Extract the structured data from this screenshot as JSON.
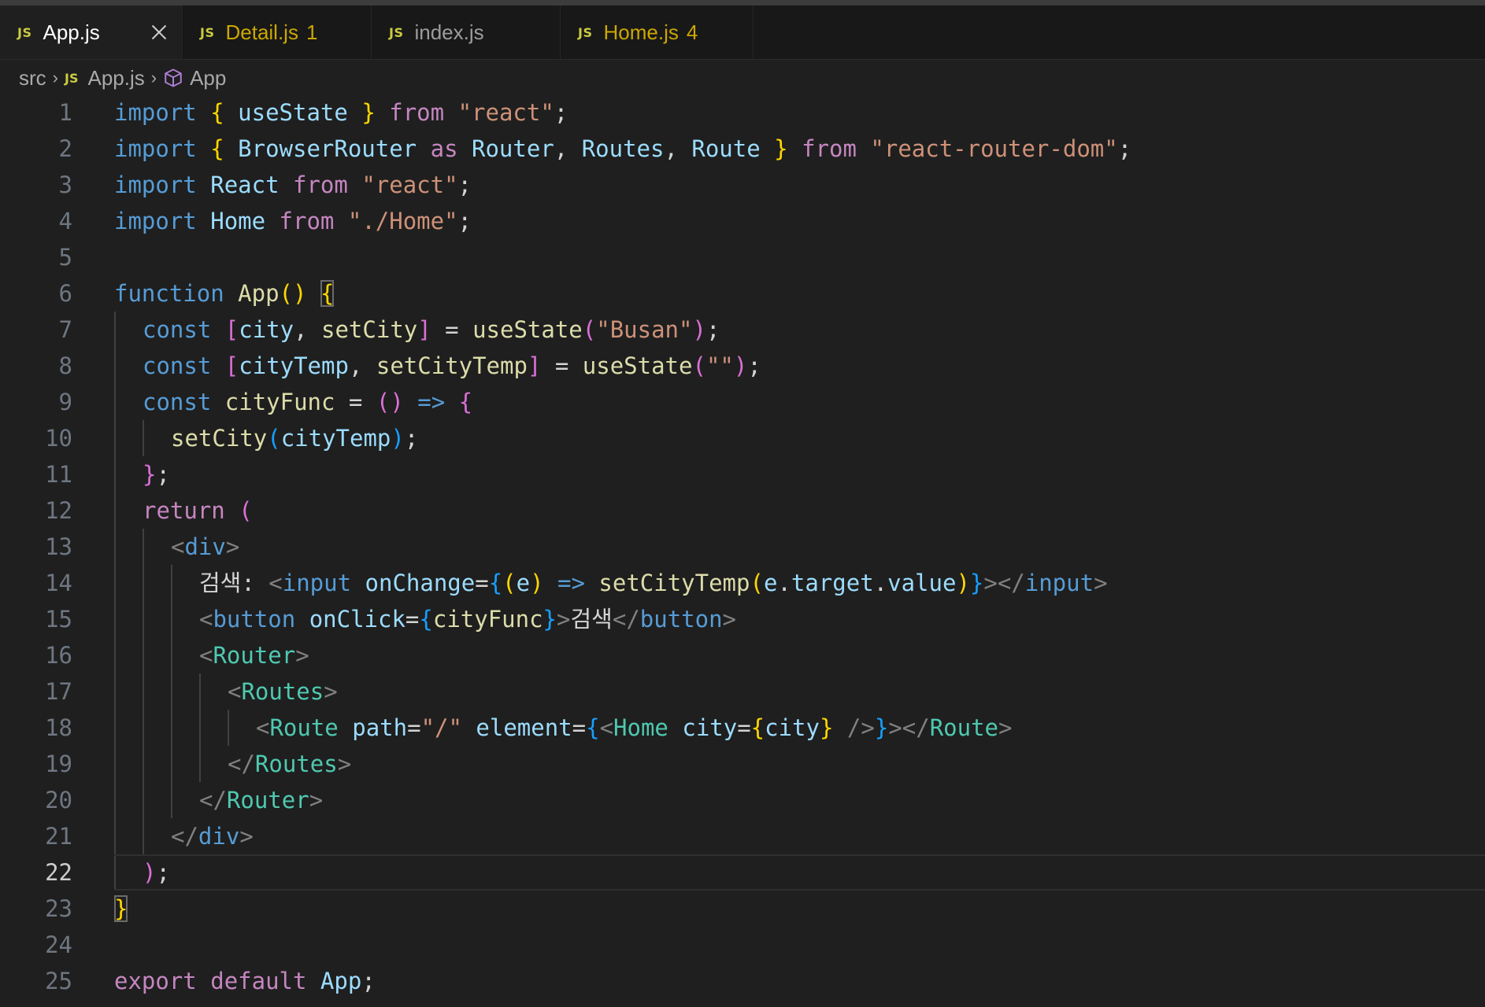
{
  "tabs": [
    {
      "icon": "JS",
      "label": "App.js",
      "count": "",
      "active": true
    },
    {
      "icon": "JS",
      "label": "Detail.js",
      "count": "1",
      "active": false
    },
    {
      "icon": "JS",
      "label": "index.js",
      "count": "",
      "active": false
    },
    {
      "icon": "JS",
      "label": "Home.js",
      "count": "4",
      "active": false
    }
  ],
  "breadcrumb": {
    "folder": "src",
    "file_icon": "JS",
    "file": "App.js",
    "symbol_icon": "symbol-class-icon",
    "symbol": "App"
  },
  "editor": {
    "current_line": 22,
    "lines": [
      {
        "n": "1",
        "indent": 0,
        "tokens": [
          [
            "kw",
            "import"
          ],
          [
            "pl",
            " "
          ],
          [
            "b1",
            "{"
          ],
          [
            "pl",
            " "
          ],
          [
            "var",
            "useState"
          ],
          [
            "pl",
            " "
          ],
          [
            "b1",
            "}"
          ],
          [
            "pl",
            " "
          ],
          [
            "ctl",
            "from"
          ],
          [
            "pl",
            " "
          ],
          [
            "str",
            "\"react\""
          ],
          [
            "pl",
            ";"
          ]
        ]
      },
      {
        "n": "2",
        "indent": 0,
        "tokens": [
          [
            "kw",
            "import"
          ],
          [
            "pl",
            " "
          ],
          [
            "b1",
            "{"
          ],
          [
            "pl",
            " "
          ],
          [
            "var",
            "BrowserRouter"
          ],
          [
            "pl",
            " "
          ],
          [
            "ctl",
            "as"
          ],
          [
            "pl",
            " "
          ],
          [
            "var",
            "Router"
          ],
          [
            "pl",
            ", "
          ],
          [
            "var",
            "Routes"
          ],
          [
            "pl",
            ", "
          ],
          [
            "var",
            "Route"
          ],
          [
            "pl",
            " "
          ],
          [
            "b1",
            "}"
          ],
          [
            "pl",
            " "
          ],
          [
            "ctl",
            "from"
          ],
          [
            "pl",
            " "
          ],
          [
            "str",
            "\"react-router-dom\""
          ],
          [
            "pl",
            ";"
          ]
        ]
      },
      {
        "n": "3",
        "indent": 0,
        "tokens": [
          [
            "kw",
            "import"
          ],
          [
            "pl",
            " "
          ],
          [
            "var",
            "React"
          ],
          [
            "pl",
            " "
          ],
          [
            "ctl",
            "from"
          ],
          [
            "pl",
            " "
          ],
          [
            "str",
            "\"react\""
          ],
          [
            "pl",
            ";"
          ]
        ]
      },
      {
        "n": "4",
        "indent": 0,
        "tokens": [
          [
            "kw",
            "import"
          ],
          [
            "pl",
            " "
          ],
          [
            "var",
            "Home"
          ],
          [
            "pl",
            " "
          ],
          [
            "ctl",
            "from"
          ],
          [
            "pl",
            " "
          ],
          [
            "str",
            "\"./Home\""
          ],
          [
            "pl",
            ";"
          ]
        ]
      },
      {
        "n": "5",
        "indent": 0,
        "tokens": []
      },
      {
        "n": "6",
        "indent": 0,
        "tokens": [
          [
            "kw",
            "function"
          ],
          [
            "pl",
            " "
          ],
          [
            "fn",
            "App"
          ],
          [
            "b1",
            "()"
          ],
          [
            "pl",
            " "
          ],
          [
            "b1 match",
            "{"
          ]
        ]
      },
      {
        "n": "7",
        "indent": 1,
        "tokens": [
          [
            "kw",
            "const"
          ],
          [
            "pl",
            " "
          ],
          [
            "b2",
            "["
          ],
          [
            "var",
            "city"
          ],
          [
            "pl",
            ", "
          ],
          [
            "fn",
            "setCity"
          ],
          [
            "b2",
            "]"
          ],
          [
            "pl",
            " = "
          ],
          [
            "fn",
            "useState"
          ],
          [
            "b2",
            "("
          ],
          [
            "str",
            "\"Busan\""
          ],
          [
            "b2",
            ")"
          ],
          [
            "pl",
            ";"
          ]
        ]
      },
      {
        "n": "8",
        "indent": 1,
        "tokens": [
          [
            "kw",
            "const"
          ],
          [
            "pl",
            " "
          ],
          [
            "b2",
            "["
          ],
          [
            "var",
            "cityTemp"
          ],
          [
            "pl",
            ", "
          ],
          [
            "fn",
            "setCityTemp"
          ],
          [
            "b2",
            "]"
          ],
          [
            "pl",
            " = "
          ],
          [
            "fn",
            "useState"
          ],
          [
            "b2",
            "("
          ],
          [
            "str",
            "\"\""
          ],
          [
            "b2",
            ")"
          ],
          [
            "pl",
            ";"
          ]
        ]
      },
      {
        "n": "9",
        "indent": 1,
        "tokens": [
          [
            "kw",
            "const"
          ],
          [
            "pl",
            " "
          ],
          [
            "fn",
            "cityFunc"
          ],
          [
            "pl",
            " = "
          ],
          [
            "b2",
            "()"
          ],
          [
            "pl",
            " "
          ],
          [
            "kw",
            "=>"
          ],
          [
            "pl",
            " "
          ],
          [
            "b2",
            "{"
          ]
        ]
      },
      {
        "n": "10",
        "indent": 2,
        "tokens": [
          [
            "fn",
            "setCity"
          ],
          [
            "b3",
            "("
          ],
          [
            "var",
            "cityTemp"
          ],
          [
            "b3",
            ")"
          ],
          [
            "pl",
            ";"
          ]
        ]
      },
      {
        "n": "11",
        "indent": 1,
        "tokens": [
          [
            "b2",
            "}"
          ],
          [
            "pl",
            ";"
          ]
        ]
      },
      {
        "n": "12",
        "indent": 1,
        "tokens": [
          [
            "ctl",
            "return"
          ],
          [
            "pl",
            " "
          ],
          [
            "b2",
            "("
          ]
        ]
      },
      {
        "n": "13",
        "indent": 2,
        "tokens": [
          [
            "ang",
            "<"
          ],
          [
            "tag",
            "div"
          ],
          [
            "ang",
            ">"
          ]
        ]
      },
      {
        "n": "14",
        "indent": 3,
        "tokens": [
          [
            "pl",
            "검색: "
          ],
          [
            "ang",
            "<"
          ],
          [
            "tag",
            "input"
          ],
          [
            "pl",
            " "
          ],
          [
            "var",
            "onChange"
          ],
          [
            "pl",
            "="
          ],
          [
            "b3",
            "{"
          ],
          [
            "b1",
            "("
          ],
          [
            "var",
            "e"
          ],
          [
            "b1",
            ")"
          ],
          [
            "pl",
            " "
          ],
          [
            "kw",
            "=>"
          ],
          [
            "pl",
            " "
          ],
          [
            "fn",
            "setCityTemp"
          ],
          [
            "b1",
            "("
          ],
          [
            "var",
            "e"
          ],
          [
            "pl",
            "."
          ],
          [
            "var",
            "target"
          ],
          [
            "pl",
            "."
          ],
          [
            "var",
            "value"
          ],
          [
            "b1",
            ")"
          ],
          [
            "b3",
            "}"
          ],
          [
            "ang",
            "></"
          ],
          [
            "tag",
            "input"
          ],
          [
            "ang",
            ">"
          ]
        ]
      },
      {
        "n": "15",
        "indent": 3,
        "tokens": [
          [
            "ang",
            "<"
          ],
          [
            "tag",
            "button"
          ],
          [
            "pl",
            " "
          ],
          [
            "var",
            "onClick"
          ],
          [
            "pl",
            "="
          ],
          [
            "b3",
            "{"
          ],
          [
            "fn",
            "cityFunc"
          ],
          [
            "b3",
            "}"
          ],
          [
            "ang",
            ">"
          ],
          [
            "pl",
            "검색"
          ],
          [
            "ang",
            "</"
          ],
          [
            "tag",
            "button"
          ],
          [
            "ang",
            ">"
          ]
        ]
      },
      {
        "n": "16",
        "indent": 3,
        "tokens": [
          [
            "ang",
            "<"
          ],
          [
            "cmp",
            "Router"
          ],
          [
            "ang",
            ">"
          ]
        ]
      },
      {
        "n": "17",
        "indent": 4,
        "tokens": [
          [
            "ang",
            "<"
          ],
          [
            "cmp",
            "Routes"
          ],
          [
            "ang",
            ">"
          ]
        ]
      },
      {
        "n": "18",
        "indent": 5,
        "tokens": [
          [
            "ang",
            "<"
          ],
          [
            "cmp",
            "Route"
          ],
          [
            "pl",
            " "
          ],
          [
            "var",
            "path"
          ],
          [
            "pl",
            "="
          ],
          [
            "str",
            "\"/\""
          ],
          [
            "pl",
            " "
          ],
          [
            "var",
            "element"
          ],
          [
            "pl",
            "="
          ],
          [
            "b3",
            "{"
          ],
          [
            "ang",
            "<"
          ],
          [
            "cmp",
            "Home"
          ],
          [
            "pl",
            " "
          ],
          [
            "var",
            "city"
          ],
          [
            "pl",
            "="
          ],
          [
            "b1",
            "{"
          ],
          [
            "var",
            "city"
          ],
          [
            "b1",
            "}"
          ],
          [
            "pl",
            " "
          ],
          [
            "ang",
            "/>"
          ],
          [
            "b3",
            "}"
          ],
          [
            "ang",
            "></"
          ],
          [
            "cmp",
            "Route"
          ],
          [
            "ang",
            ">"
          ]
        ]
      },
      {
        "n": "19",
        "indent": 4,
        "tokens": [
          [
            "ang",
            "</"
          ],
          [
            "cmp",
            "Routes"
          ],
          [
            "ang",
            ">"
          ]
        ]
      },
      {
        "n": "20",
        "indent": 3,
        "tokens": [
          [
            "ang",
            "</"
          ],
          [
            "cmp",
            "Router"
          ],
          [
            "ang",
            ">"
          ]
        ]
      },
      {
        "n": "21",
        "indent": 2,
        "tokens": [
          [
            "ang",
            "</"
          ],
          [
            "tag",
            "div"
          ],
          [
            "ang",
            ">"
          ]
        ]
      },
      {
        "n": "22",
        "indent": 1,
        "tokens": [
          [
            "b2",
            ")"
          ],
          [
            "pl",
            ";"
          ]
        ]
      },
      {
        "n": "23",
        "indent": 0,
        "tokens": [
          [
            "b1 match",
            "}"
          ]
        ]
      },
      {
        "n": "24",
        "indent": 0,
        "tokens": []
      },
      {
        "n": "25",
        "indent": 0,
        "tokens": [
          [
            "ctl",
            "export"
          ],
          [
            "pl",
            " "
          ],
          [
            "ctl",
            "default"
          ],
          [
            "pl",
            " "
          ],
          [
            "var",
            "App"
          ],
          [
            "pl",
            ";"
          ]
        ]
      }
    ]
  }
}
